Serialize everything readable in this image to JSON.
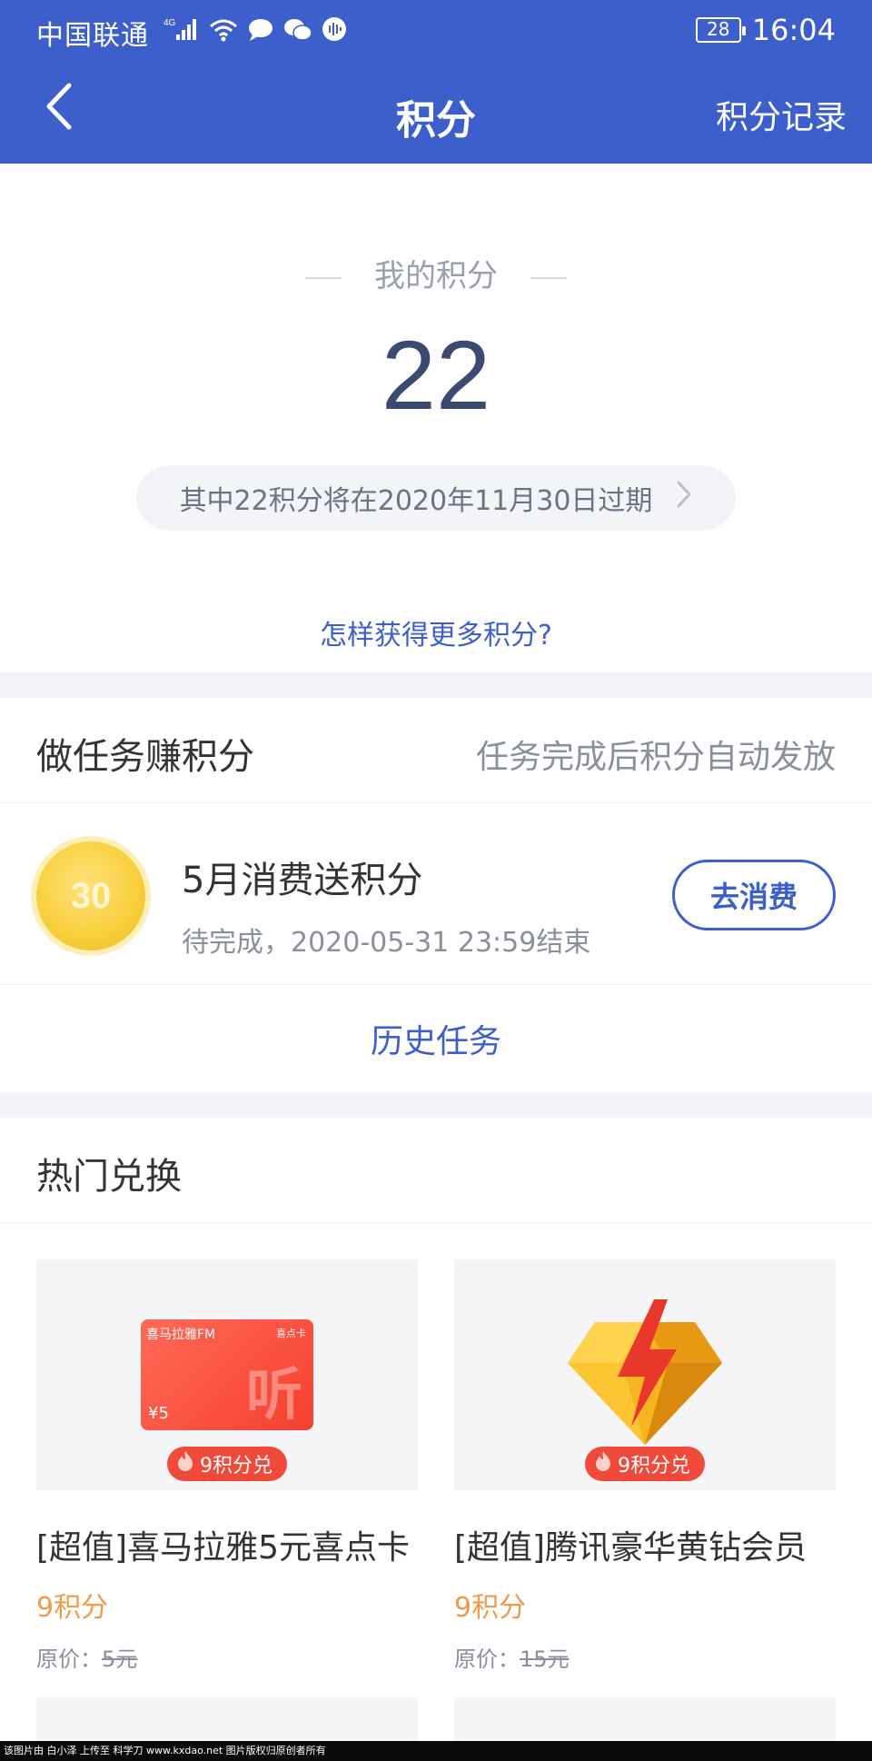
{
  "status_bar": {
    "carrier": "中国联通",
    "network": "4G",
    "battery": "28",
    "time": "16:04"
  },
  "nav": {
    "title": "积分",
    "record_label": "积分记录"
  },
  "points": {
    "label": "我的积分",
    "value": "22",
    "expire_notice": "其中22积分将在2020年11月30日过期",
    "how_to_link": "怎样获得更多积分?"
  },
  "tasks": {
    "title": "做任务赚积分",
    "subtitle": "任务完成后积分自动发放",
    "items": [
      {
        "coin_value": "30",
        "title": "5月消费送积分",
        "status": "待完成，2020-05-31 23:59结束",
        "button": "去消费"
      }
    ],
    "history_label": "历史任务"
  },
  "hot": {
    "title": "热门兑换",
    "products": [
      {
        "badge": "9积分兑",
        "name": "[超值]喜马拉雅5元喜点卡",
        "price": "9积分",
        "orig_label": "原价：",
        "orig_value": "5元",
        "card_brand": "喜马拉雅FM",
        "card_tag": "喜点卡",
        "card_value": "¥5",
        "card_glyph": "听"
      },
      {
        "badge": "9积分兑",
        "name": "[超值]腾讯豪华黄钻会员",
        "price": "9积分",
        "orig_label": "原价：",
        "orig_value": "15元"
      }
    ]
  },
  "footer": {
    "text": "该图片由 白小泽 上传至 科学刀 www.kxdao.net 图片版权归原创者所有"
  },
  "colors": {
    "brand_blue": "#3d5fcb",
    "price_orange": "#f09a4a",
    "badge_red": "#f24a3a"
  }
}
